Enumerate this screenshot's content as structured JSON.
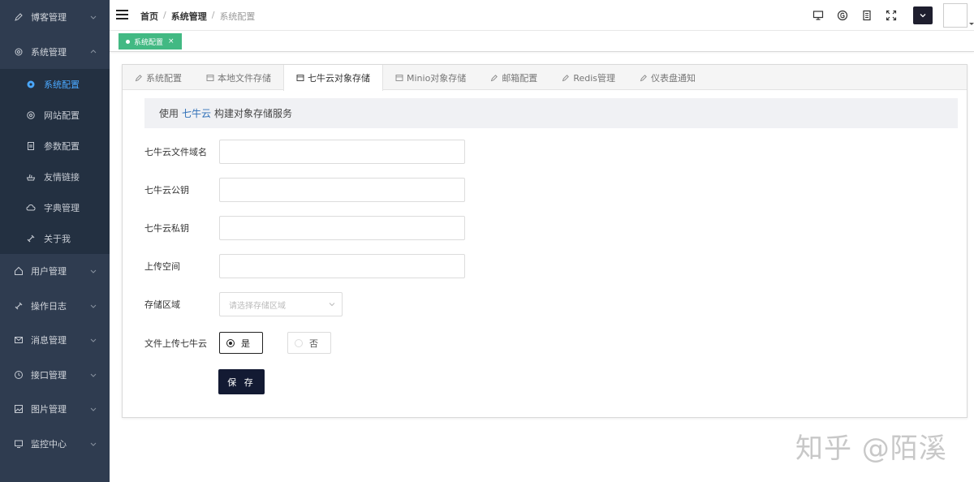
{
  "sidebar": {
    "items_top": [
      {
        "label": "博客管理",
        "icon": "pencil-icon"
      },
      {
        "label": "系统管理",
        "icon": "gear-icon"
      }
    ],
    "sub_items": [
      {
        "label": "系统配置",
        "icon": "gear-icon",
        "active": true
      },
      {
        "label": "网站配置",
        "icon": "gear-outline-icon"
      },
      {
        "label": "参数配置",
        "icon": "document-icon"
      },
      {
        "label": "友情链接",
        "icon": "hand-icon"
      },
      {
        "label": "字典管理",
        "icon": "cloud-icon"
      },
      {
        "label": "关于我",
        "icon": "link-icon"
      }
    ],
    "items_bottom": [
      {
        "label": "用户管理",
        "icon": "home-icon"
      },
      {
        "label": "操作日志",
        "icon": "link-icon"
      },
      {
        "label": "消息管理",
        "icon": "mail-icon"
      },
      {
        "label": "接口管理",
        "icon": "clock-icon"
      },
      {
        "label": "图片管理",
        "icon": "image-icon"
      },
      {
        "label": "监控中心",
        "icon": "monitor-icon"
      }
    ]
  },
  "header": {
    "breadcrumb": [
      "首页",
      "系统管理",
      "系统配置"
    ]
  },
  "tagbar": {
    "tag_label": "系统配置",
    "tag_close": "×"
  },
  "tabs": [
    {
      "label": "系统配置",
      "icon": "edit-icon"
    },
    {
      "label": "本地文件存储",
      "icon": "calendar-icon"
    },
    {
      "label": "七牛云对象存储",
      "icon": "calendar-icon",
      "active": true
    },
    {
      "label": "Minio对象存储",
      "icon": "calendar-icon"
    },
    {
      "label": "邮箱配置",
      "icon": "edit-icon"
    },
    {
      "label": "Redis管理",
      "icon": "edit-icon"
    },
    {
      "label": "仪表盘通知",
      "icon": "edit-icon"
    }
  ],
  "banner": {
    "prefix": "使用",
    "highlight": "七牛云",
    "suffix": "构建对象存储服务"
  },
  "form": {
    "domain_label": "七牛云文件域名",
    "domain_value": "",
    "access_key_label": "七牛云公钥",
    "access_key_value": "",
    "secret_key_label": "七牛云私钥",
    "secret_key_value": "",
    "bucket_label": "上传空间",
    "bucket_value": "",
    "region_label": "存储区域",
    "region_placeholder": "请选择存储区域",
    "upload_label": "文件上传七牛云",
    "radio_yes": "是",
    "radio_no": "否",
    "upload_selected": "是",
    "save_label": "保 存"
  },
  "watermark": "知乎 @陌溪",
  "colors": {
    "sidebar_bg": "#2f3c50",
    "active_menu": "#4aa8ff",
    "tag_green": "#42b983",
    "save_button": "#131a33",
    "banner_highlight": "#3070b8"
  }
}
